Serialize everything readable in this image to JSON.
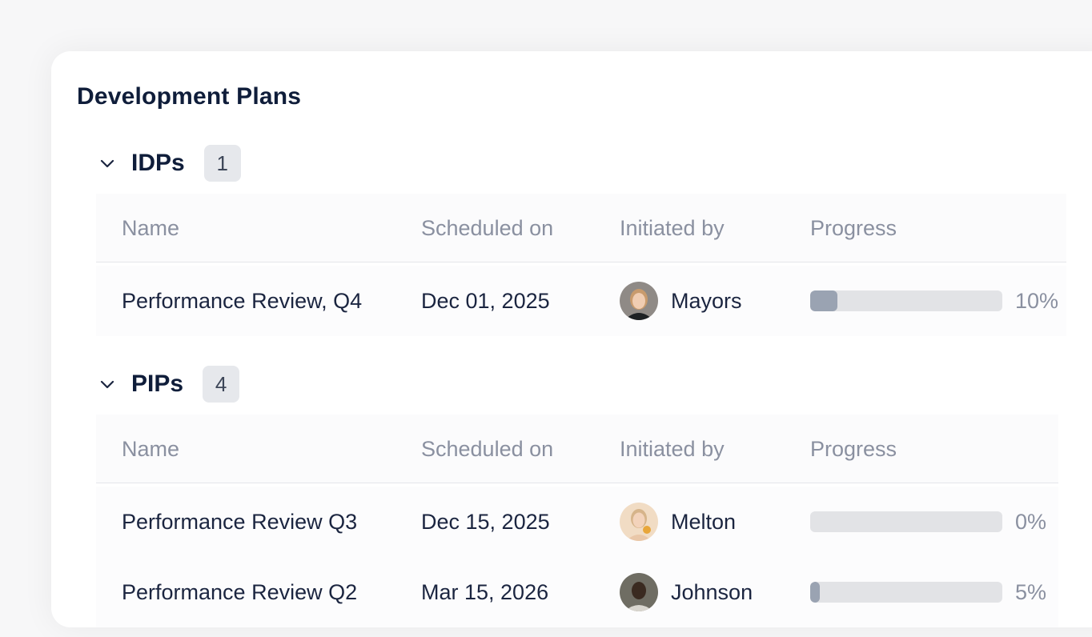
{
  "page": {
    "title": "Development Plans"
  },
  "columns": {
    "name": "Name",
    "scheduled": "Scheduled on",
    "initiated": "Initiated by",
    "progress": "Progress"
  },
  "idps": {
    "title": "IDPs",
    "count": "1",
    "rows": [
      {
        "name": "Performance Review, Q4",
        "date": "Dec 01, 2025",
        "person": "Mayors",
        "avatar": "avatar-woman-blonde",
        "progress": 0.1,
        "progress_label": "10%"
      }
    ]
  },
  "pips": {
    "title": "PIPs",
    "count": "4",
    "rows": [
      {
        "name": "Performance Review Q3",
        "date": "Dec 15, 2025",
        "person": "Melton",
        "avatar": "avatar-woman-light",
        "progress": 0.0,
        "progress_label": "0%"
      },
      {
        "name": "Performance Review Q2",
        "date": "Mar 15, 2026",
        "person": "Johnson",
        "avatar": "avatar-man-dark",
        "progress": 0.05,
        "progress_label": "5%"
      }
    ]
  },
  "colors": {
    "title": "#0f1d3a",
    "muted": "#8a90a0",
    "bar_track": "#e2e3e6",
    "bar_fill": "#9aa3b2",
    "badge_bg": "#e6e8ec"
  }
}
